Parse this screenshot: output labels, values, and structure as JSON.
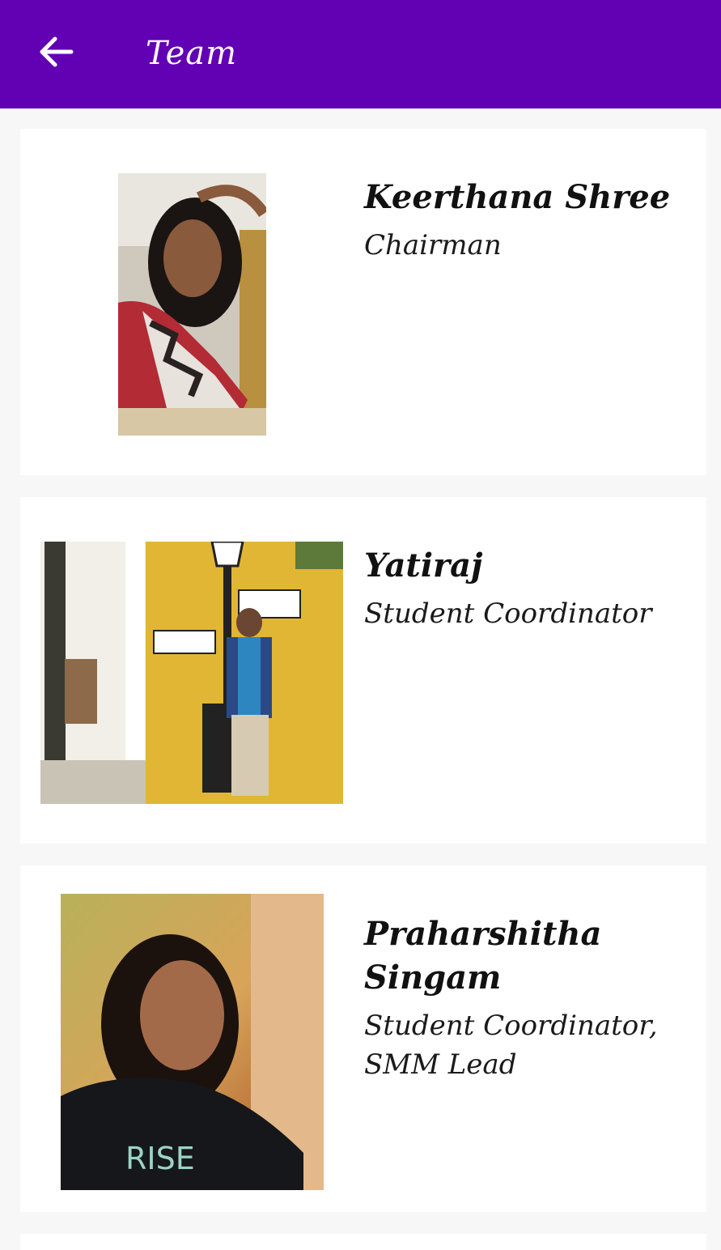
{
  "appbar": {
    "back_icon": "arrow-left-icon",
    "title": "Team",
    "background": "#6200b4"
  },
  "members": [
    {
      "name": "Keerthana Shree",
      "role": "Chairman",
      "photo": "person-photo"
    },
    {
      "name": "Yatiraj",
      "role": "Student Coordinator",
      "photo": "person-photo"
    },
    {
      "name": "Praharshitha Singam",
      "role": "Student Coordinator, SMM Lead",
      "photo": "person-photo"
    }
  ]
}
